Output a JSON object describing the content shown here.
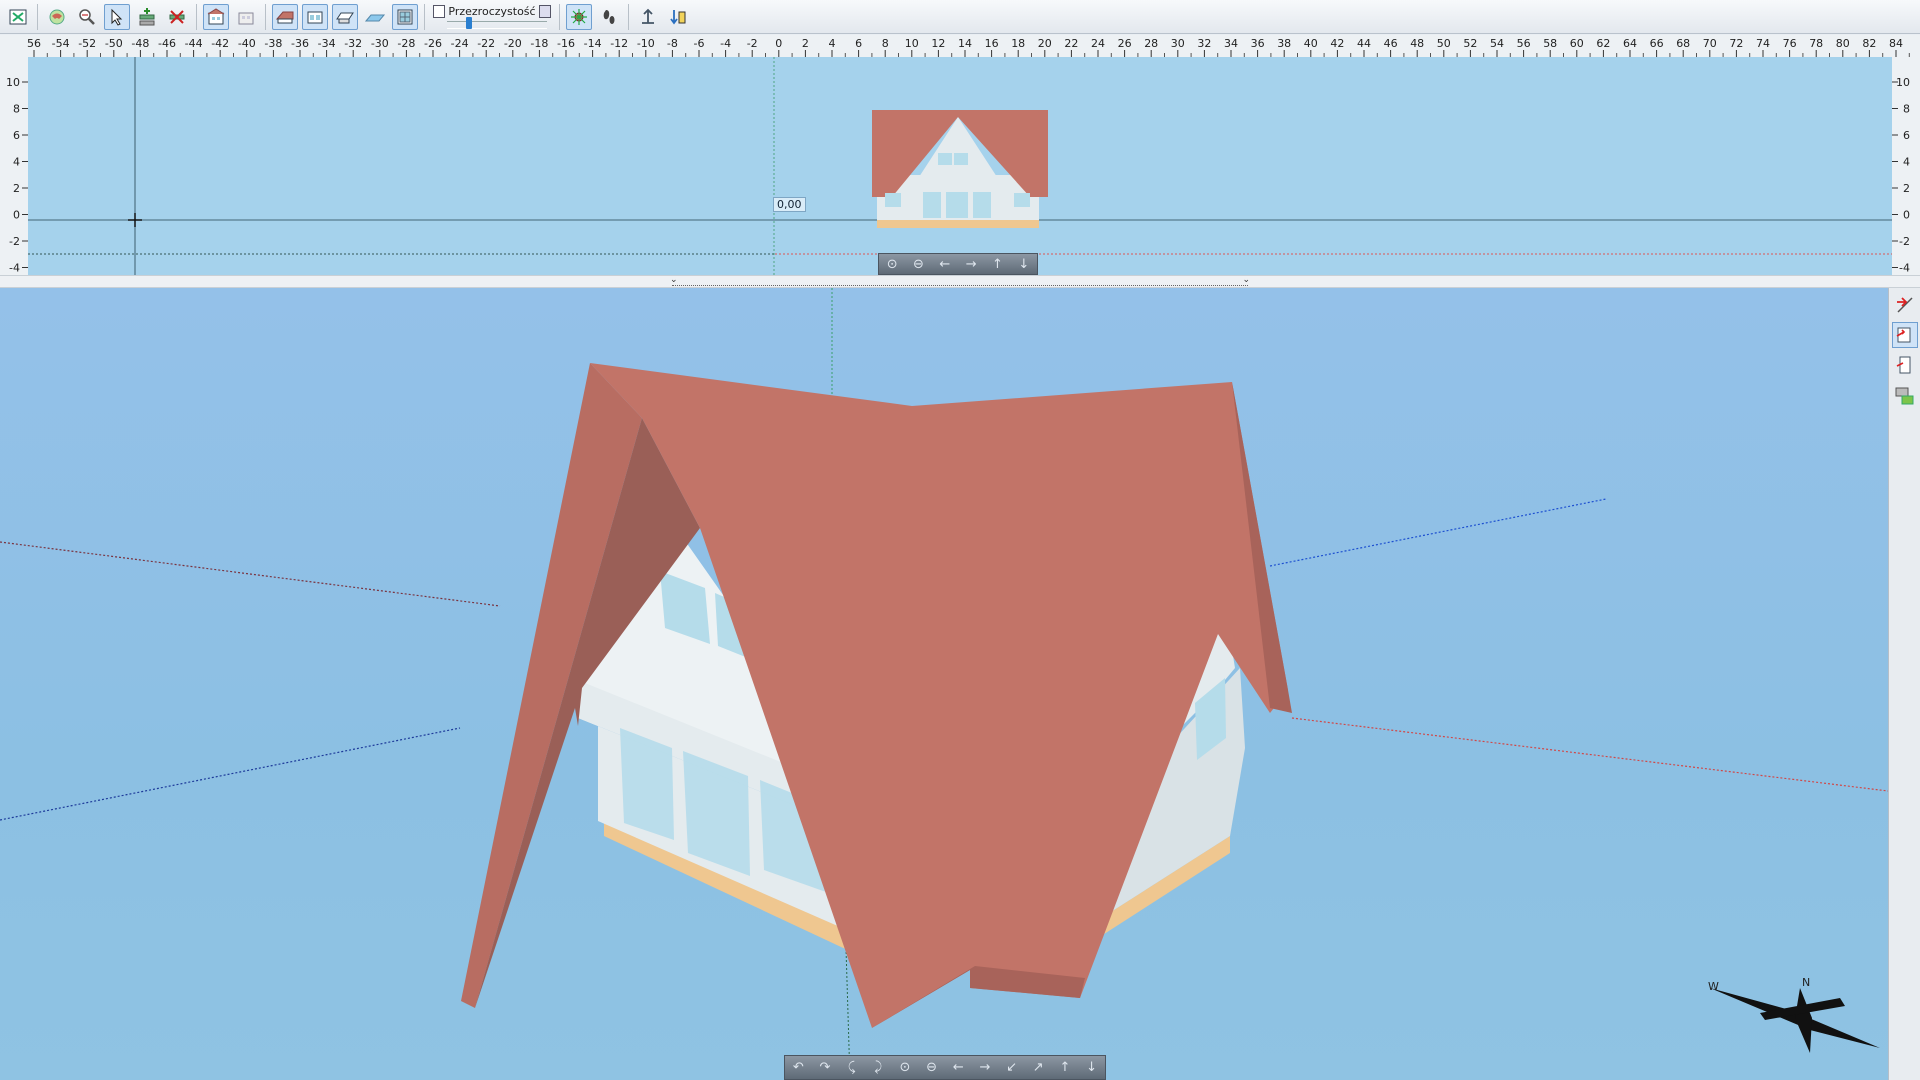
{
  "toolbar": {
    "transparency_label": "Przezroczystość",
    "transparency_value": 0.2,
    "buttons": [
      {
        "name": "app-menu-icon",
        "active": false
      },
      {
        "name": "orbit-icon",
        "active": false
      },
      {
        "name": "zoom-icon",
        "active": false
      },
      {
        "name": "select-arrow-icon",
        "active": true
      },
      {
        "name": "add-level-icon",
        "active": false
      },
      {
        "name": "remove-level-icon",
        "active": false
      },
      {
        "name": "view-building-icon",
        "active": true
      },
      {
        "name": "view-floor-icon",
        "active": false
      },
      {
        "name": "view-roof-icon",
        "active": true
      },
      {
        "name": "view-walls-icon",
        "active": true
      },
      {
        "name": "view-slab-icon",
        "active": true
      },
      {
        "name": "view-terrain-icon",
        "active": false
      },
      {
        "name": "view-window-icon",
        "active": true
      },
      {
        "name": "camera-3d-icon",
        "active": true
      },
      {
        "name": "walk-footprint-icon",
        "active": false
      },
      {
        "name": "level-up-icon",
        "active": false
      },
      {
        "name": "level-down-icon",
        "active": false
      }
    ]
  },
  "ruler": {
    "x_labels": [
      "56",
      "-54",
      "-52",
      "-50",
      "-48",
      "-46",
      "-44",
      "-42",
      "-40",
      "-38",
      "-36",
      "-34",
      "-32",
      "-30",
      "-28",
      "-26",
      "-24",
      "-22",
      "-20",
      "-18",
      "-16",
      "-14",
      "-12",
      "-10",
      "-8",
      "-6",
      "-4",
      "-2",
      "0",
      "2",
      "4",
      "6",
      "8",
      "10",
      "12",
      "14",
      "16",
      "18",
      "20",
      "22",
      "24",
      "26",
      "28",
      "30",
      "32",
      "34",
      "36",
      "38",
      "40",
      "42",
      "44",
      "46",
      "48",
      "50",
      "52",
      "54",
      "56",
      "58",
      "60",
      "62",
      "64",
      "66",
      "68",
      "70",
      "72",
      "74",
      "76",
      "78",
      "80",
      "82",
      "84"
    ],
    "y_labels": [
      "10",
      "8",
      "6",
      "4",
      "2",
      "0",
      "-2",
      "-4"
    ]
  },
  "elevation": {
    "readout": "0,00"
  },
  "nav": {
    "elevation": [
      "⊙",
      "⊖",
      "←",
      "→",
      "↑",
      "↓"
    ],
    "view3d": [
      "↶",
      "↷",
      "⤹",
      "⤸",
      "⊙",
      "⊖",
      "←",
      "→",
      "↙",
      "↗",
      "↑",
      "↓"
    ]
  },
  "compass": {
    "north": "N",
    "west": "W"
  },
  "side_palette": [
    {
      "name": "cut-plane-icon",
      "active": false
    },
    {
      "name": "section-wall-icon",
      "active": true
    },
    {
      "name": "door-icon",
      "active": false
    },
    {
      "name": "camera-list-icon",
      "active": false
    }
  ],
  "colors": {
    "roof": "#c27468",
    "roof_dark": "#9a5f57",
    "wall": "#e4ebee",
    "wall_shade": "#cfd9de",
    "foundation": "#efc790",
    "window": "#b5dcea",
    "sky": "#8fc2e6",
    "elev_bg": "#a5d2ec"
  }
}
